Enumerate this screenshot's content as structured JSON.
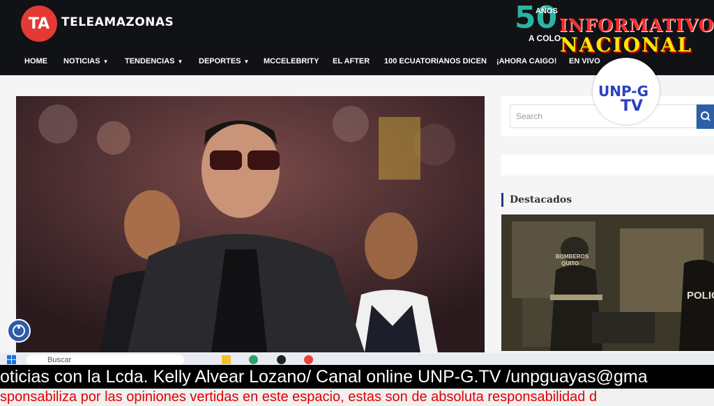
{
  "site": {
    "logo_text": "TA",
    "brand": "TELEAMAZONAS",
    "anniversary_number": "50",
    "anniversary_word": "AÑOS",
    "anniversary_tagline": "A COLO"
  },
  "overlay": {
    "line1": "INFORMATIVO",
    "line2": "NACIONAL",
    "badge_line1": "UNP-G",
    "badge_line2": "TV"
  },
  "nav": {
    "items": [
      {
        "label": "HOME"
      },
      {
        "label": "NOTICIAS"
      },
      {
        "label": "TENDENCIAS"
      },
      {
        "label": "DEPORTES"
      },
      {
        "label": "MCCELEBRITY"
      },
      {
        "label": "EL AFTER"
      },
      {
        "label": "100 ECUATORIANOS DICEN"
      },
      {
        "label": "¡AHORA CAIGO!"
      },
      {
        "label": "EN VIVO"
      }
    ]
  },
  "sidebar": {
    "search_placeholder": "Search",
    "section_title": "Destacados",
    "featured_text_1": "BOMBEROS",
    "featured_text_2": "QUITO",
    "featured_text_3": "POLIC"
  },
  "taskbar": {
    "search_placeholder": "Buscar"
  },
  "ticker": {
    "line1": "oticias con la Lcda. Kelly Alvear Lozano/ Canal online UNP-G.TV /unpguayas@gma",
    "line2": "sponsabiliza por las opiniones vertidas en este espacio, estas son de absoluta responsabilidad d"
  },
  "colors": {
    "topbar": "#111215",
    "logo_red": "#e53935",
    "search_button": "#2c5fa8",
    "ticker_red": "#e10000",
    "informativo_red": "#ff2a2a",
    "nacional_yellow": "#ffe600"
  }
}
